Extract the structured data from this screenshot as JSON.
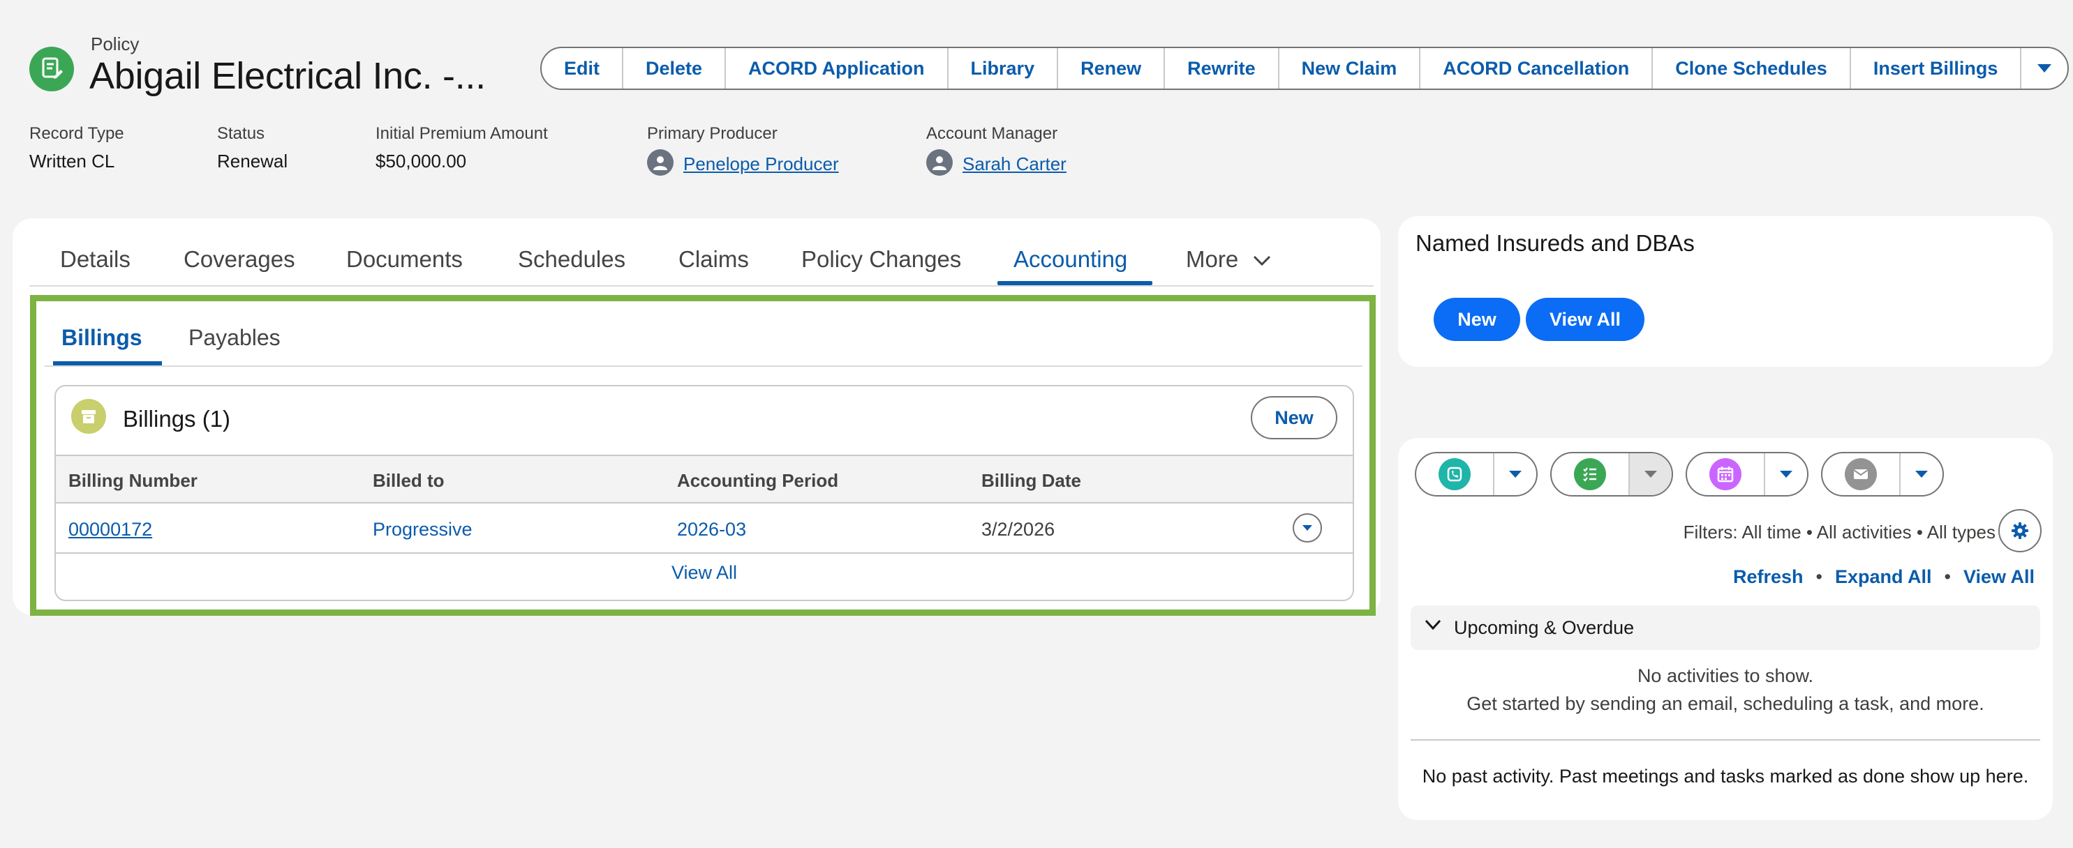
{
  "header": {
    "object_label": "Policy",
    "title": "Abigail Electrical Inc. -...",
    "actions": [
      "Edit",
      "Delete",
      "ACORD Application",
      "Library",
      "Renew",
      "Rewrite",
      "New Claim",
      "ACORD Cancellation",
      "Clone Schedules",
      "Insert Billings"
    ],
    "fields": {
      "record_type": {
        "label": "Record Type",
        "value": "Written CL"
      },
      "status": {
        "label": "Status",
        "value": "Renewal"
      },
      "premium": {
        "label": "Initial Premium Amount",
        "value": "$50,000.00"
      },
      "producer": {
        "label": "Primary Producer",
        "value": "Penelope Producer"
      },
      "manager": {
        "label": "Account Manager",
        "value": "Sarah Carter"
      }
    }
  },
  "tabs": [
    "Details",
    "Coverages",
    "Documents",
    "Schedules",
    "Claims",
    "Policy Changes",
    "Accounting",
    "More"
  ],
  "active_tab": "Accounting",
  "subtabs": [
    "Billings",
    "Payables"
  ],
  "billings": {
    "title": "Billings (1)",
    "new_label": "New",
    "columns": [
      "Billing Number",
      "Billed to",
      "Accounting Period",
      "Billing Date"
    ],
    "rows": [
      {
        "number": "00000172",
        "billed_to": "Progressive",
        "period": "2026-03",
        "date": "3/2/2026"
      }
    ],
    "view_all": "View All"
  },
  "named_insureds": {
    "title": "Named Insureds and DBAs",
    "new_label": "New",
    "view_all_label": "View All"
  },
  "activity": {
    "filters": "Filters: All time • All activities • All types",
    "links": [
      "Refresh",
      "Expand All",
      "View All"
    ],
    "upcoming_label": "Upcoming & Overdue",
    "empty_line1": "No activities to show.",
    "empty_line2": "Get started by sending an email, scheduling a task, and more.",
    "past_text": "No past activity. Past meetings and tasks marked as done show up here.",
    "colors": {
      "call": "#1fb5a8",
      "task": "#3ba755",
      "event": "#cb65ff",
      "email": "#939393"
    }
  },
  "colors": {
    "brand": "#0b5cab",
    "accent_pill": "#0b6cf5",
    "highlight_frame": "#7cb342",
    "policy_icon": "#3ba755"
  }
}
